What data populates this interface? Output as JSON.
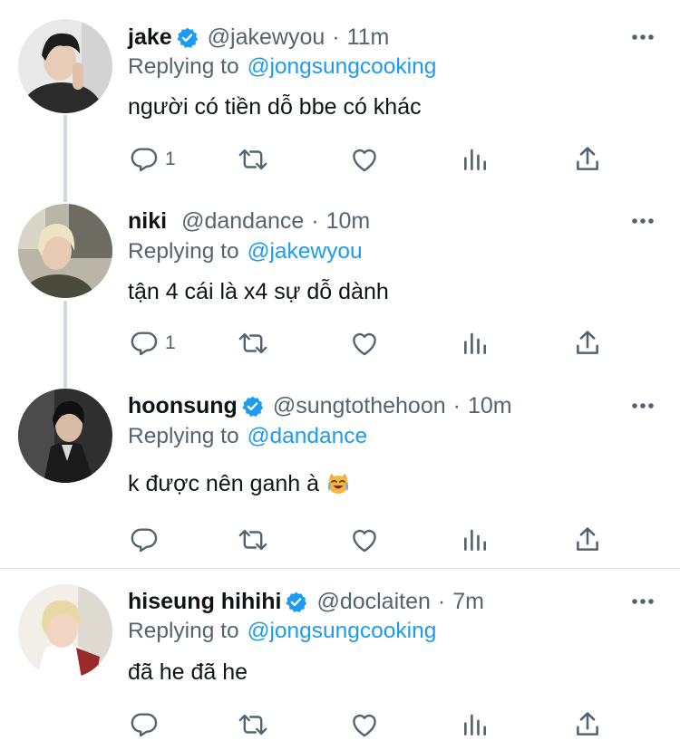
{
  "colors": {
    "link": "#1d9bf0",
    "secondary_text": "#536471",
    "primary_text": "#0f1419",
    "verified_badge": "#1d9bf0",
    "thread_line": "#cfd9de"
  },
  "tweets": [
    {
      "display_name": "jake",
      "verified": true,
      "handle": "@jakewyou",
      "separator": "·",
      "time": "11m",
      "replying_prefix": "Replying to",
      "replying_to": "@jongsungcooking",
      "text": "người có tiền dỗ bbe có khác",
      "reply_count": "1",
      "avatar": "profile-photo"
    },
    {
      "display_name": "niki",
      "verified": false,
      "handle": "@dandance",
      "separator": "·",
      "time": "10m",
      "replying_prefix": "Replying to",
      "replying_to": "@jakewyou",
      "text": "tận 4 cái là x4 sự dỗ dành",
      "reply_count": "1",
      "avatar": "profile-photo"
    },
    {
      "display_name": "hoonsung",
      "verified": true,
      "handle": "@sungtothehoon",
      "separator": "·",
      "time": "10m",
      "replying_prefix": "Replying to",
      "replying_to": "@dandance",
      "text": "k được nên ganh à",
      "emoji": "laughing-crying-cat-emoji",
      "reply_count": "",
      "avatar": "profile-photo"
    },
    {
      "display_name": "hiseung hihihi",
      "verified": true,
      "handle": "@doclaiten",
      "separator": "·",
      "time": "7m",
      "replying_prefix": "Replying to",
      "replying_to": "@jongsungcooking",
      "text": "đã he đã he",
      "reply_count": "",
      "avatar": "profile-photo"
    }
  ],
  "icons": {
    "reply": "reply-icon",
    "retweet": "retweet-icon",
    "like": "heart-icon",
    "analytics": "analytics-icon",
    "share": "share-icon",
    "more": "more-icon",
    "verified": "verified-badge-icon"
  }
}
